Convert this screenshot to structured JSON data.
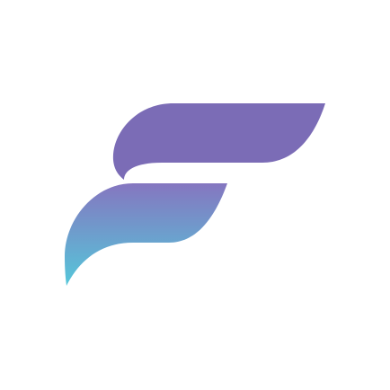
{
  "logo": {
    "icon": "f-letter-logo-icon",
    "colors": {
      "background": "#ffffff",
      "top_stroke": "#7B6CB6",
      "gradient_top": "#8576C0",
      "gradient_bottom": "#55C7DA"
    }
  }
}
